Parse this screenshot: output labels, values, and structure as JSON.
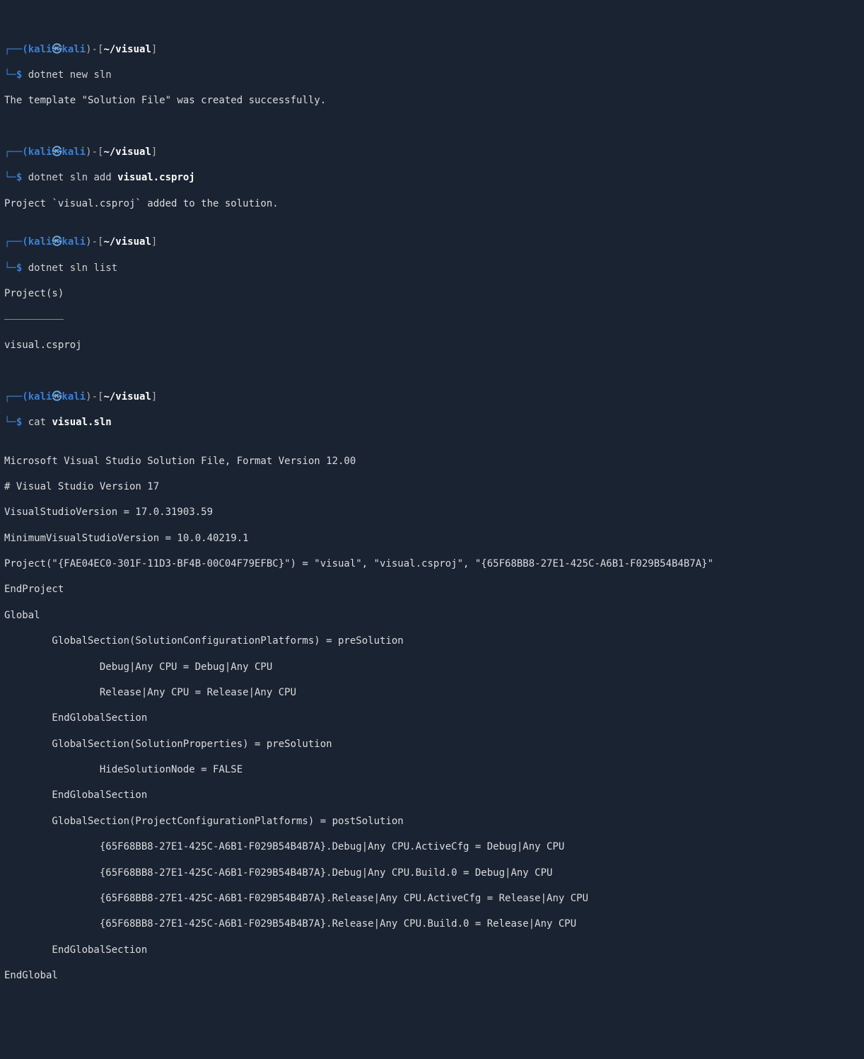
{
  "prompts": [
    {
      "top_open": "┌──(",
      "user": "kali",
      "skull": "㉿",
      "host": "kali",
      "top_mid": ")-[",
      "path": "~/visual",
      "top_close": "]",
      "bottom_open": "└─$ ",
      "cmd_hl": "dotnet",
      "cmd_rest": " new sln",
      "outputs": [
        "The template \"Solution File\" was created successfully.",
        ""
      ]
    },
    {
      "top_open": "┌──(",
      "user": "kali",
      "skull": "㉿",
      "host": "kali",
      "top_mid": ")-[",
      "path": "~/visual",
      "top_close": "]",
      "bottom_open": "└─$ ",
      "cmd_hl": "dotnet",
      "cmd_rest_pre": " sln add ",
      "cmd_arg_bold": "visual.csproj",
      "outputs": [
        "Project `visual.csproj` added to the solution."
      ]
    },
    {
      "top_open": "┌──(",
      "user": "kali",
      "skull": "㉿",
      "host": "kali",
      "top_mid": ")-[",
      "path": "~/visual",
      "top_close": "]",
      "bottom_open": "└─$ ",
      "cmd_hl": "dotnet",
      "cmd_rest": " sln list",
      "outputs": [
        "Project(s)",
        "__RULE__",
        "visual.csproj",
        ""
      ]
    },
    {
      "top_open": "┌──(",
      "user": "kali",
      "skull": "㉿",
      "host": "kali",
      "top_mid": ")-[",
      "path": "~/visual",
      "top_close": "]",
      "bottom_open": "└─$ ",
      "cmd_hl": "cat",
      "cmd_rest_pre": " ",
      "cmd_arg_bold": "visual.sln",
      "outputs": [
        "",
        "Microsoft Visual Studio Solution File, Format Version 12.00",
        "# Visual Studio Version 17",
        "VisualStudioVersion = 17.0.31903.59",
        "MinimumVisualStudioVersion = 10.0.40219.1",
        "Project(\"{FAE04EC0-301F-11D3-BF4B-00C04F79EFBC}\") = \"visual\", \"visual.csproj\", \"{65F68BB8-27E1-425C-A6B1-F029B54B4B7A}\"",
        "EndProject",
        "Global",
        "        GlobalSection(SolutionConfigurationPlatforms) = preSolution",
        "                Debug|Any CPU = Debug|Any CPU",
        "                Release|Any CPU = Release|Any CPU",
        "        EndGlobalSection",
        "        GlobalSection(SolutionProperties) = preSolution",
        "                HideSolutionNode = FALSE",
        "        EndGlobalSection",
        "        GlobalSection(ProjectConfigurationPlatforms) = postSolution",
        "                {65F68BB8-27E1-425C-A6B1-F029B54B4B7A}.Debug|Any CPU.ActiveCfg = Debug|Any CPU",
        "                {65F68BB8-27E1-425C-A6B1-F029B54B4B7A}.Debug|Any CPU.Build.0 = Debug|Any CPU",
        "                {65F68BB8-27E1-425C-A6B1-F029B54B4B7A}.Release|Any CPU.ActiveCfg = Release|Any CPU",
        "                {65F68BB8-27E1-425C-A6B1-F029B54B4B7A}.Release|Any CPU.Build.0 = Release|Any CPU",
        "        EndGlobalSection",
        "EndGlobal"
      ]
    }
  ]
}
